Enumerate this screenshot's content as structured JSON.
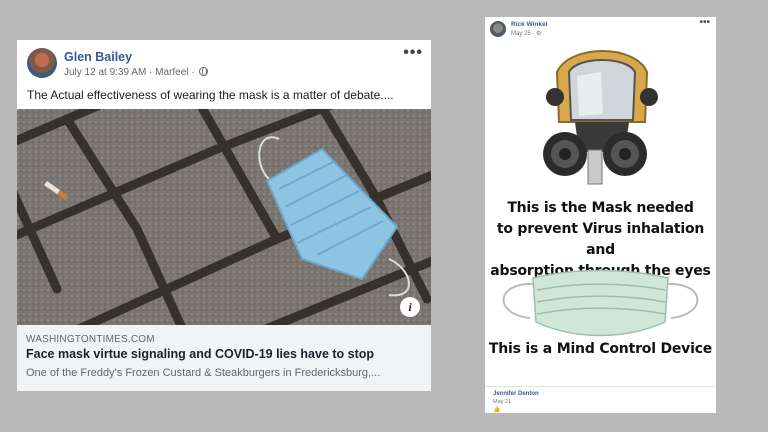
{
  "post_left": {
    "author": "Glen Bailey",
    "timestamp": "July 12 at 9:39 AM",
    "separator": " · ",
    "location": "Marfeel",
    "separator2": " · ",
    "privacy_icon": "globe-icon",
    "more_label": "•••",
    "text": "The Actual effectiveness of wearing the mask is a matter of debate....",
    "image_icon": "info-icon",
    "info_label": "i",
    "link": {
      "domain": "WASHINGTONTIMES.COM",
      "title": "Face mask virtue signaling and COVID-19 lies have to stop",
      "description": "One of the Freddy's Frozen Custard & Steakburgers in Fredericksburg,..."
    }
  },
  "post_right": {
    "author": "Rick Winkel",
    "date": "May 25",
    "separator": " · ",
    "privacy_icon": "settings-gear-icon",
    "more_label": "•••",
    "meme": {
      "caption_top": [
        "This is the Mask needed",
        "to prevent Virus inhalation and",
        "absorption through the eyes"
      ],
      "caption_bottom": "This is a Mind Control Device"
    },
    "comment": {
      "author": "Jennifer Denton",
      "date": "May 21",
      "reaction_icon": "like-icon"
    }
  },
  "colors": {
    "background": "#b9b9b9",
    "link_blue": "#385898",
    "mask_blue": "#8cc4e2"
  }
}
